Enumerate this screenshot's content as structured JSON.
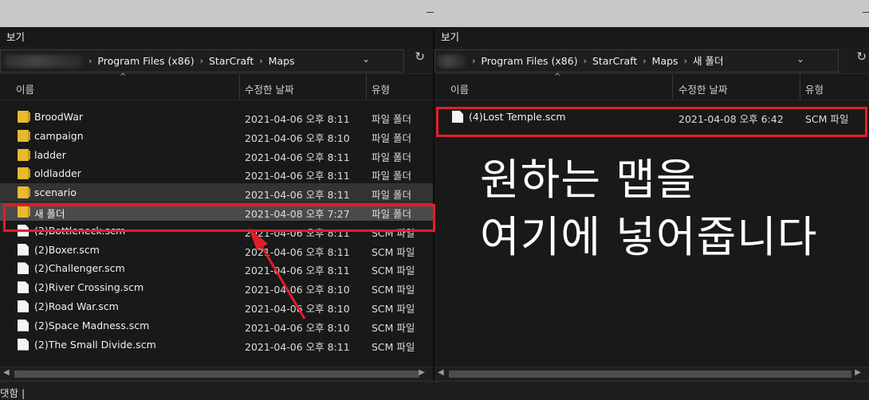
{
  "left": {
    "menu": "보기",
    "breadcrumb": [
      "Program Files (x86)",
      "StarCraft",
      "Maps"
    ],
    "columns": {
      "name": "이름",
      "date": "수정한 날짜",
      "type": "유형"
    },
    "rows": [
      {
        "name": "BroodWar",
        "date": "2021-04-06 오후 8:11",
        "type": "파일 폴더",
        "icon": "folder-icon"
      },
      {
        "name": "campaign",
        "date": "2021-04-06 오후 8:10",
        "type": "파일 폴더",
        "icon": "folder-icon"
      },
      {
        "name": "ladder",
        "date": "2021-04-06 오후 8:11",
        "type": "파일 폴더",
        "icon": "folder-icon"
      },
      {
        "name": "oldladder",
        "date": "2021-04-06 오후 8:11",
        "type": "파일 폴더",
        "icon": "folder-icon"
      },
      {
        "name": "scenario",
        "date": "2021-04-06 오후 8:11",
        "type": "파일 폴더",
        "icon": "folder-icon"
      },
      {
        "name": "새 폴더",
        "date": "2021-04-08 오후 7:27",
        "type": "파일 폴더",
        "icon": "folder-icon"
      },
      {
        "name": "(2)Bottleneck.scm",
        "date": "2021-04-06 오후 8:11",
        "type": "SCM 파일",
        "icon": "file-icon"
      },
      {
        "name": "(2)Boxer.scm",
        "date": "2021-04-06 오후 8:11",
        "type": "SCM 파일",
        "icon": "file-icon"
      },
      {
        "name": "(2)Challenger.scm",
        "date": "2021-04-06 오후 8:11",
        "type": "SCM 파일",
        "icon": "file-icon"
      },
      {
        "name": "(2)River Crossing.scm",
        "date": "2021-04-06 오후 8:10",
        "type": "SCM 파일",
        "icon": "file-icon"
      },
      {
        "name": "(2)Road War.scm",
        "date": "2021-04-06 오후 8:10",
        "type": "SCM 파일",
        "icon": "file-icon"
      },
      {
        "name": "(2)Space Madness.scm",
        "date": "2021-04-06 오후 8:10",
        "type": "SCM 파일",
        "icon": "file-icon"
      },
      {
        "name": "(2)The Small Divide.scm",
        "date": "2021-04-06 오후 8:11",
        "type": "SCM 파일",
        "icon": "file-icon"
      }
    ]
  },
  "right": {
    "menu": "보기",
    "breadcrumb": [
      "Program Files (x86)",
      "StarCraft",
      "Maps",
      "새 폴더"
    ],
    "columns": {
      "name": "이름",
      "date": "수정한 날짜",
      "type": "유형"
    },
    "rows": [
      {
        "name": "(4)Lost Temple.scm",
        "date": "2021-04-08 오후 6:42",
        "type": "SCM 파일",
        "icon": "file-icon"
      }
    ]
  },
  "overlay": {
    "line1": "원하는 맵을",
    "line2": "여기에 넣어줍니다"
  },
  "status": "댓함  |",
  "colors": {
    "highlight": "#e01e2a",
    "background": "#191919",
    "folder": "#e9b92f"
  }
}
